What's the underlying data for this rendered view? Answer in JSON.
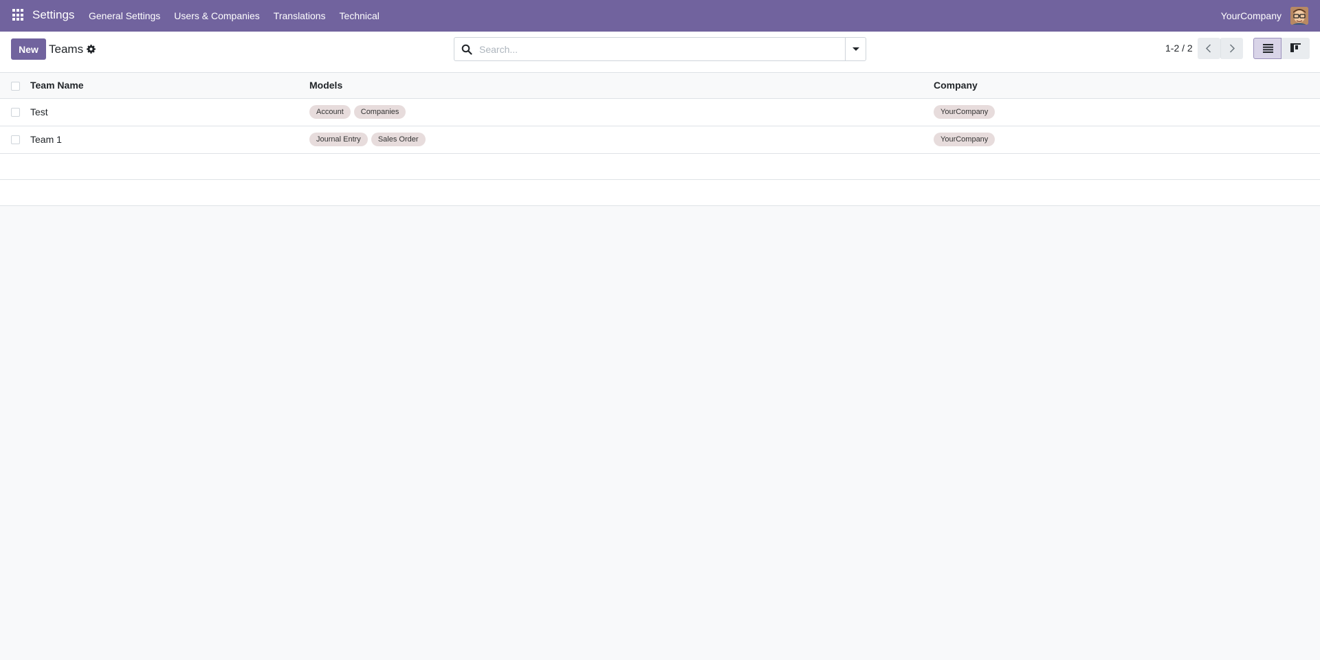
{
  "navbar": {
    "app_name": "Settings",
    "menu": [
      "General Settings",
      "Users & Companies",
      "Translations",
      "Technical"
    ],
    "company": "YourCompany",
    "icons": [
      "apps-grid-icon",
      "avatar"
    ]
  },
  "control_panel": {
    "new_label": "New",
    "title": "Teams",
    "search_placeholder": "Search...",
    "pager": "1-2 / 2"
  },
  "list": {
    "columns": [
      "Team Name",
      "Models",
      "Company"
    ],
    "rows": [
      {
        "name": "Test",
        "models": [
          "Account",
          "Companies"
        ],
        "company": "YourCompany"
      },
      {
        "name": "Team 1",
        "models": [
          "Journal Entry",
          "Sales Order"
        ],
        "company": "YourCompany"
      }
    ]
  },
  "colors": {
    "brand": "#71639e",
    "tag_bg": "#e7dcdc",
    "background": "#f8f9fa"
  }
}
